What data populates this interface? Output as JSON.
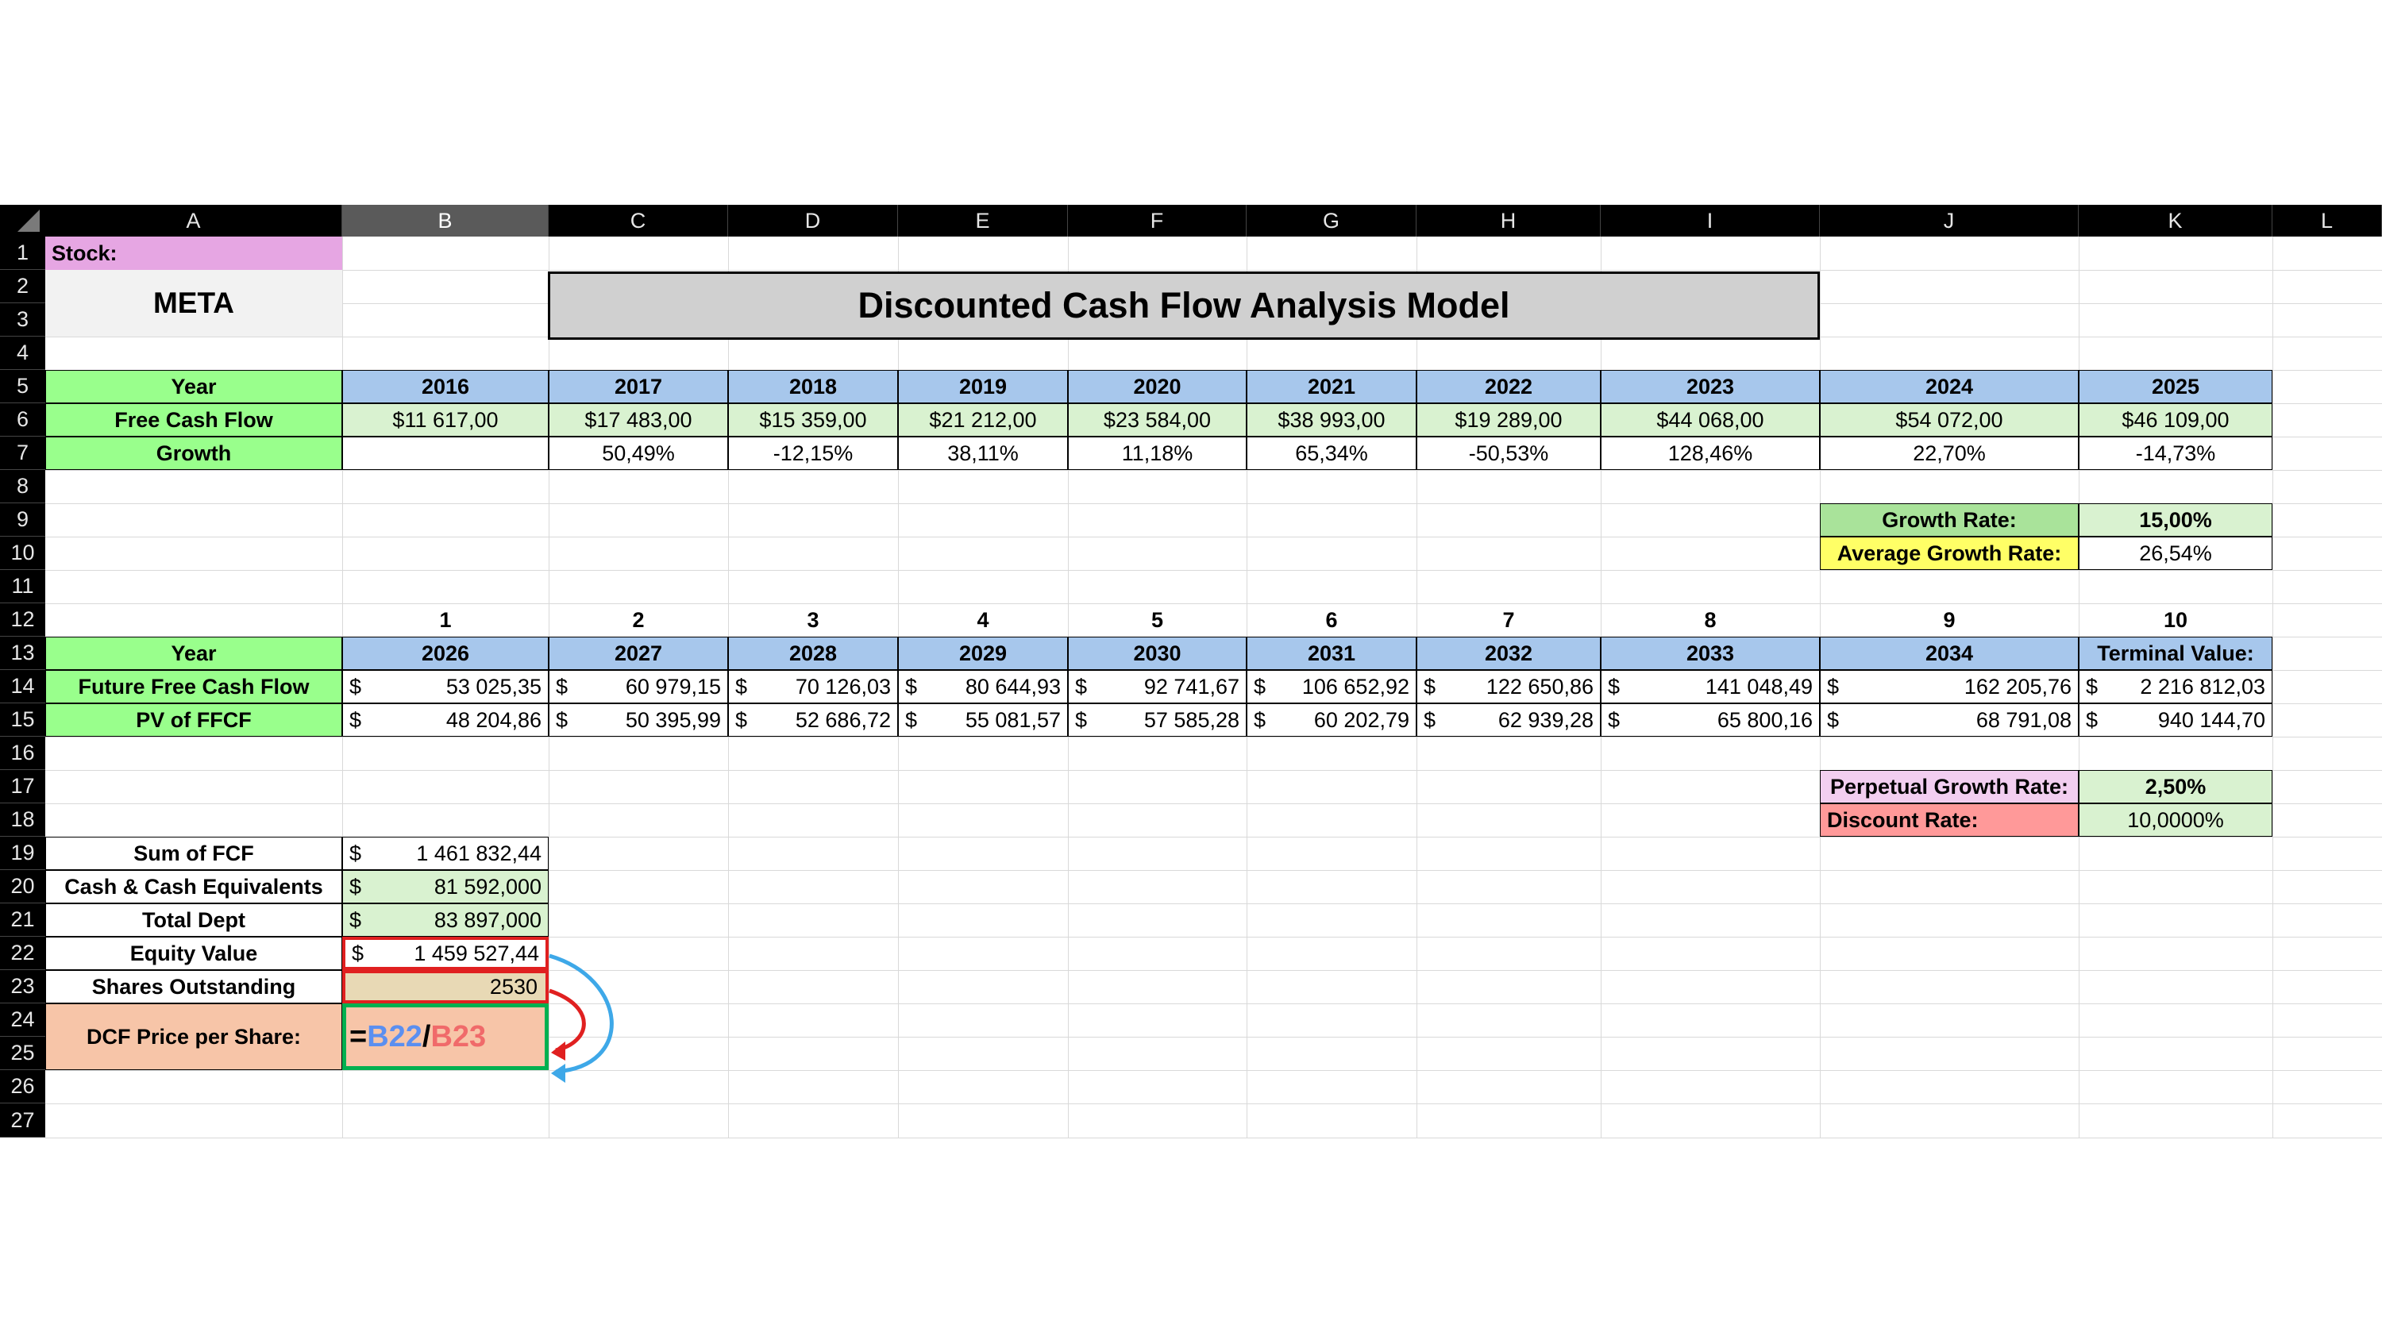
{
  "columns": [
    "A",
    "B",
    "C",
    "D",
    "E",
    "F",
    "G",
    "H",
    "I",
    "J",
    "K",
    "L"
  ],
  "rows": [
    "1",
    "2",
    "3",
    "4",
    "5",
    "6",
    "7",
    "8",
    "9",
    "10",
    "11",
    "12",
    "13",
    "14",
    "15",
    "16",
    "17",
    "18",
    "19",
    "20",
    "21",
    "22",
    "23",
    "24",
    "25",
    "26",
    "27"
  ],
  "stock": {
    "label": "Stock:",
    "ticker": "META"
  },
  "title": "Discounted Cash Flow Analysis Model",
  "historical": {
    "year_label": "Year",
    "fcf_label": "Free Cash Flow",
    "growth_label": "Growth",
    "years": [
      "2016",
      "2017",
      "2018",
      "2019",
      "2020",
      "2021",
      "2022",
      "2023",
      "2024",
      "2025"
    ],
    "fcf": [
      "$11 617,00",
      "$17 483,00",
      "$15 359,00",
      "$21 212,00",
      "$23 584,00",
      "$38 993,00",
      "$19 289,00",
      "$44 068,00",
      "$54 072,00",
      "$46 109,00"
    ],
    "growth": [
      "",
      "50,49%",
      "-12,15%",
      "38,11%",
      "11,18%",
      "65,34%",
      "-50,53%",
      "128,46%",
      "22,70%",
      "-14,73%"
    ]
  },
  "rates": {
    "growth_rate_label": "Growth Rate:",
    "growth_rate": "15,00%",
    "avg_growth_label": "Average Growth Rate:",
    "avg_growth": "26,54%",
    "perpetual_label": "Perpetual Growth Rate:",
    "perpetual": "2,50%",
    "discount_label": "Discount Rate:",
    "discount": "10,0000%"
  },
  "future": {
    "periods": [
      "1",
      "2",
      "3",
      "4",
      "5",
      "6",
      "7",
      "8",
      "9",
      "10"
    ],
    "year_label": "Year",
    "ffcf_label": "Future Free Cash Flow",
    "pv_label": "PV of FFCF",
    "years": [
      "2026",
      "2027",
      "2028",
      "2029",
      "2030",
      "2031",
      "2032",
      "2033",
      "2034",
      "Terminal Value:"
    ],
    "currency": "$",
    "ffcf": [
      "53 025,35",
      "60 979,15",
      "70 126,03",
      "80 644,93",
      "92 741,67",
      "106 652,92",
      "122 650,86",
      "141 048,49",
      "162 205,76",
      "2 216 812,03"
    ],
    "pv": [
      "48 204,86",
      "50 395,99",
      "52 686,72",
      "55 081,57",
      "57 585,28",
      "60 202,79",
      "62 939,28",
      "65 800,16",
      "68 791,08",
      "940 144,70"
    ]
  },
  "summary": {
    "currency": "$",
    "items": [
      {
        "label": "Sum of FCF",
        "value": "1 461 832,44"
      },
      {
        "label": "Cash & Cash Equivalents",
        "value": "81 592,000"
      },
      {
        "label": "Total Dept",
        "value": "83 897,000"
      },
      {
        "label": "Equity Value",
        "value": "1 459 527,44"
      }
    ],
    "shares_label": "Shares Outstanding",
    "shares": "2530",
    "dcf_label": "DCF Price per Share:",
    "formula": {
      "eq": "=",
      "ref1": "B22",
      "slash": "/",
      "ref2": "B23"
    }
  },
  "colors": {
    "stock_label_bg": "#e6a6e3",
    "label_green": "#99ff8c",
    "header_blue": "#a7c7ec",
    "value_green": "#d9f2d0",
    "avg_yellow": "#ffff66",
    "perpetual_pink": "#f2cef0",
    "discount_red": "#ff9999",
    "dcf_orange": "#f7c5a8",
    "ref_blue": "#5b8ff0",
    "ref_red": "#f06a6a",
    "highlight_red": "#e02020",
    "highlight_green": "#00b050",
    "arrow_blue": "#3ea8e8"
  }
}
